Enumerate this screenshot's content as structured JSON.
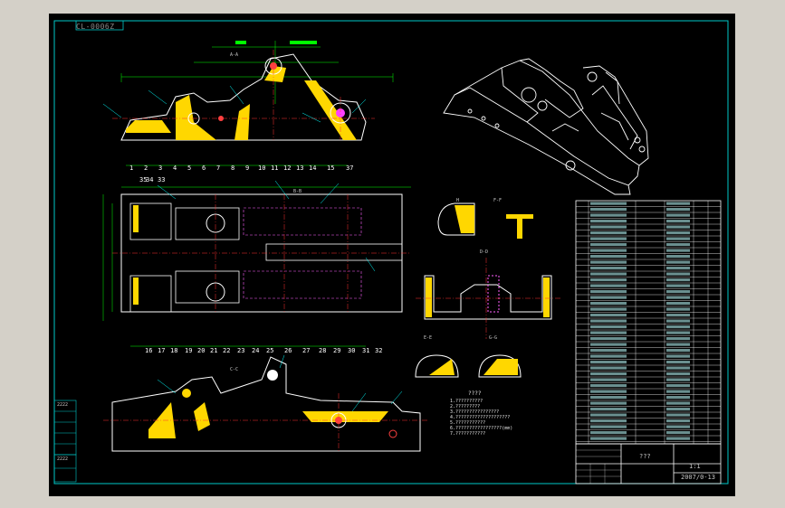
{
  "drawing": {
    "code_tag": "CL-0006Z",
    "scale_label": "1:1",
    "drawing_no": "2007/0-13",
    "title_mark": "???",
    "side_label_a": "2222",
    "side_label_b": "2222",
    "notes_title": "????",
    "notes": [
      "1.??????????",
      "2.?????????",
      "3.????????????????",
      "4.????????????????????",
      "5.???????????",
      "6.?????????????????(mm)",
      "7.???????????"
    ],
    "section_labels": [
      "A-A",
      "B-B",
      "C-C",
      "D-D",
      "E-E",
      "F-F",
      "G-G",
      "H"
    ],
    "balloons_top": [
      "1",
      "2",
      "3",
      "4",
      "5",
      "6",
      "7",
      "8",
      "9",
      "10",
      "11",
      "12",
      "13",
      "14",
      "15",
      "37"
    ],
    "balloons_mid_top": [
      "35",
      "34",
      "33"
    ],
    "balloons_mid_bottom": [
      "16",
      "17",
      "18",
      "19",
      "20",
      "21",
      "22",
      "23",
      "24",
      "25",
      "26",
      "27",
      "28",
      "29",
      "30",
      "31",
      "32"
    ]
  },
  "colors": {
    "frame": "#00c8c8",
    "part": "#ffffff",
    "dim": "#00ff00",
    "center": "#ff3030",
    "hatch": "#ffd700",
    "hidden": "#ff60ff",
    "leader": "#00ffff"
  }
}
